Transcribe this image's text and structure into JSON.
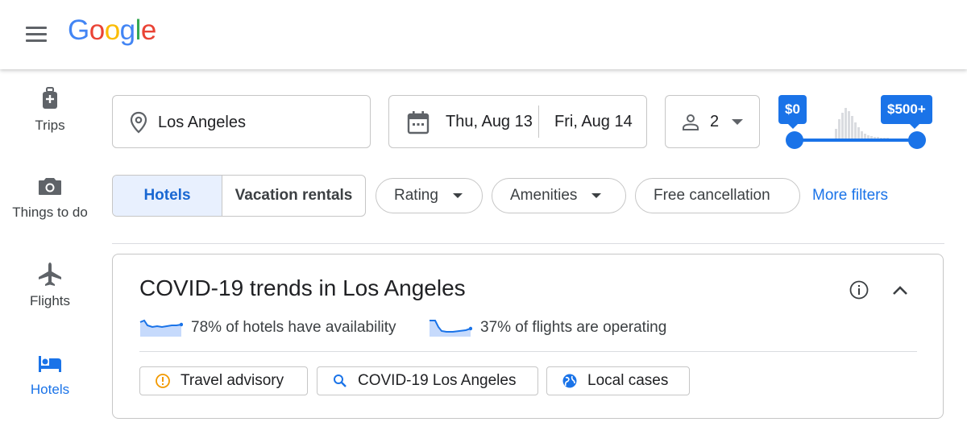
{
  "logo": {
    "text": "Google",
    "letters": [
      {
        "ch": "G",
        "color": "#4285F4"
      },
      {
        "ch": "o",
        "color": "#EA4335"
      },
      {
        "ch": "o",
        "color": "#FBBC05"
      },
      {
        "ch": "g",
        "color": "#4285F4"
      },
      {
        "ch": "l",
        "color": "#34A853"
      },
      {
        "ch": "e",
        "color": "#EA4335"
      }
    ]
  },
  "sidebar": {
    "items": [
      {
        "label": "Trips",
        "icon": "luggage-icon"
      },
      {
        "label": "Things to do",
        "icon": "camera-icon"
      },
      {
        "label": "Flights",
        "icon": "airplane-icon"
      },
      {
        "label": "Hotels",
        "icon": "bed-icon",
        "active": true
      }
    ]
  },
  "search": {
    "location": "Los Angeles",
    "checkin": "Thu, Aug 13",
    "checkout": "Fri, Aug 14",
    "guests": "2"
  },
  "price": {
    "min_label": "$0",
    "max_label": "$500+"
  },
  "filters": {
    "tabs": [
      "Hotels",
      "Vacation rentals"
    ],
    "rating": "Rating",
    "amenities": "Amenities",
    "free_cancellation": "Free cancellation",
    "more": "More filters"
  },
  "covid": {
    "title": "COVID-19 trends in Los Angeles",
    "hotels_stat": "78% of hotels have availability",
    "flights_stat": "37% of flights are operating",
    "links": {
      "advisory": "Travel advisory",
      "search": "COVID-19 Los Angeles",
      "cases": "Local cases"
    }
  },
  "colors": {
    "accent": "#1a73e8",
    "active_bg": "#e8f0fe",
    "warning": "#f29900"
  }
}
